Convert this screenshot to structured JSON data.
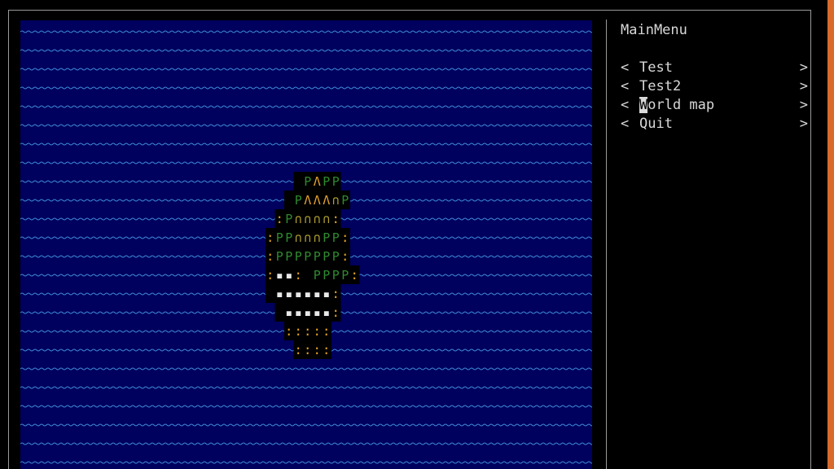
{
  "menu": {
    "title": "MainMenu",
    "left_arrow": "<",
    "right_arrow": ">",
    "items": [
      {
        "label": "Test"
      },
      {
        "label": "Test2"
      },
      {
        "label": "World map",
        "selected": true,
        "cursor_char": "W",
        "rest": "orld map"
      },
      {
        "label": "Quit"
      }
    ]
  },
  "map": {
    "ocean_glyph": "~",
    "ocean_color": "#00005e",
    "wave_color": "#3e8ad6",
    "island_glyphs": {
      "tree": "P",
      "mountain": "Λ",
      "hill": "∩",
      "beach": ":",
      "plain": "▪"
    },
    "colors": {
      "tree": "#2f8a2f",
      "mountain": "#e0a030",
      "hill": "#b0a030",
      "beach": "#e0a020",
      "plain": "#e8e8e8"
    }
  }
}
